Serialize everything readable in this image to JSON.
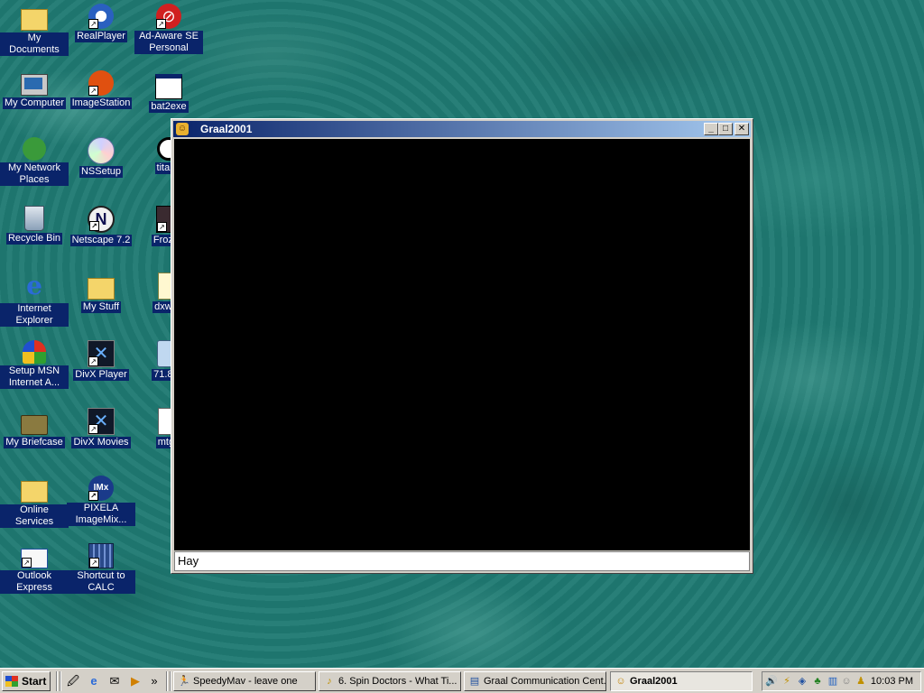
{
  "desktop": {
    "icons": [
      {
        "label": "My Documents",
        "glyph": "📁",
        "icon": "folder-documents-icon"
      },
      {
        "label": "My Computer",
        "glyph": "🖥",
        "icon": "computer-icon"
      },
      {
        "label": "My Network Places",
        "glyph": "🖧",
        "icon": "network-icon"
      },
      {
        "label": "Recycle Bin",
        "glyph": "🗑",
        "icon": "recycle-bin-icon"
      },
      {
        "label": "Internet Explorer",
        "glyph": "e",
        "icon": "internet-explorer-icon"
      },
      {
        "label": "Setup MSN Internet A...",
        "glyph": "🦋",
        "icon": "msn-icon"
      },
      {
        "label": "My Briefcase",
        "glyph": "💼",
        "icon": "briefcase-icon"
      },
      {
        "label": "Online Services",
        "glyph": "📁",
        "icon": "folder-icon"
      },
      {
        "label": "Outlook Express",
        "glyph": "✉",
        "icon": "outlook-express-icon"
      },
      {
        "label": "RealPlayer",
        "glyph": "◉",
        "icon": "realplayer-icon"
      },
      {
        "label": "ImageStation",
        "glyph": "📷",
        "icon": "imagestation-icon"
      },
      {
        "label": "NSSetup",
        "glyph": "💿",
        "icon": "setup-icon"
      },
      {
        "label": "Netscape 7.2",
        "glyph": "N",
        "icon": "netscape-icon"
      },
      {
        "label": "My Stuff",
        "glyph": "📁",
        "icon": "folder-icon"
      },
      {
        "label": "DivX Player",
        "glyph": "✕",
        "icon": "divx-player-icon"
      },
      {
        "label": "DivX Movies",
        "glyph": "✕",
        "icon": "divx-movies-icon"
      },
      {
        "label": "PIXELA ImageMix...",
        "glyph": "IMx",
        "icon": "pixela-icon"
      },
      {
        "label": "Shortcut to CALC",
        "glyph": "▦",
        "icon": "calculator-icon"
      },
      {
        "label": "Ad-Aware SE Personal",
        "glyph": "⊘",
        "icon": "ad-aware-icon"
      },
      {
        "label": "bat2exe",
        "glyph": "▭",
        "icon": "application-window-icon"
      },
      {
        "label": "titan5",
        "glyph": "🐼",
        "icon": "panda-icon"
      },
      {
        "label": "Frozen",
        "glyph": "▣",
        "icon": "film-icon"
      },
      {
        "label": "dxweb",
        "glyph": "▤",
        "icon": "installer-icon"
      },
      {
        "label": "71.84_",
        "glyph": "▢",
        "icon": "file-icon"
      },
      {
        "label": "mtge",
        "glyph": "▤",
        "icon": "document-icon"
      }
    ]
  },
  "window": {
    "title": "Graal2001",
    "minimize": "_",
    "maximize": "□",
    "close": "✕",
    "chat_value": "Hay"
  },
  "taskbar": {
    "start_label": "Start",
    "more": "»",
    "quick_launch": [
      {
        "glyph": "🖉",
        "icon": "show-desktop-icon"
      },
      {
        "glyph": "e",
        "icon": "internet-explorer-icon"
      },
      {
        "glyph": "✉",
        "icon": "outlook-express-icon"
      },
      {
        "glyph": "▶",
        "icon": "media-player-icon"
      }
    ],
    "tasks": [
      {
        "label": "SpeedyMav - leave one",
        "glyph": "🏃",
        "icon": "messenger-icon"
      },
      {
        "label": "6. Spin Doctors - What Ti...",
        "glyph": "♪",
        "icon": "winamp-icon"
      },
      {
        "label": "Graal Communication Cent...",
        "glyph": "▤",
        "icon": "window-icon"
      },
      {
        "label": "Graal2001",
        "glyph": "☺",
        "icon": "graal-icon"
      }
    ],
    "tray_icons": [
      {
        "glyph": "🔊",
        "icon": "volume-icon"
      },
      {
        "glyph": "⚡",
        "icon": "winamp-tray-icon"
      },
      {
        "glyph": "◈",
        "icon": "network-tray-icon"
      },
      {
        "glyph": "♣",
        "icon": "app-tray-icon"
      },
      {
        "glyph": "▥",
        "icon": "monitor-tray-icon"
      },
      {
        "glyph": "☺",
        "icon": "messenger-tray-icon"
      },
      {
        "glyph": "♟",
        "icon": "aim-tray-icon"
      }
    ],
    "clock": "10:03 PM"
  }
}
